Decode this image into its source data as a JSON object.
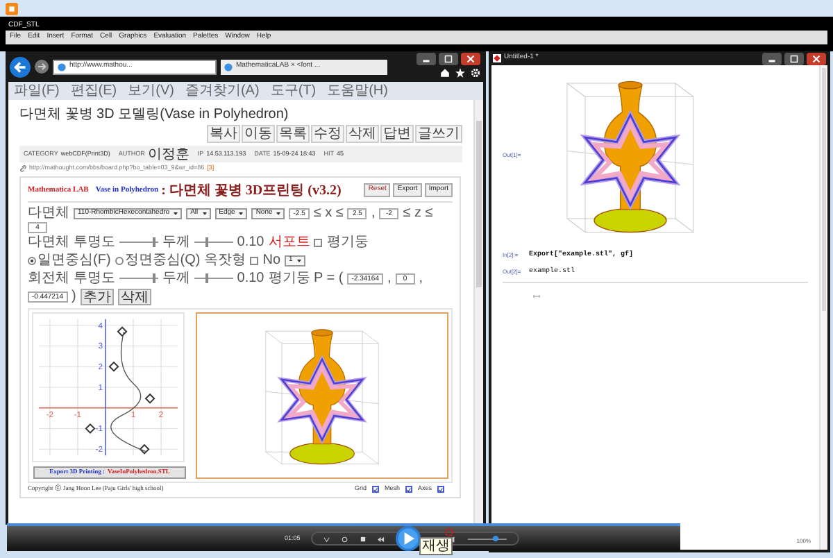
{
  "top_window": {
    "title": "CDF_STL",
    "menu": [
      "File",
      "Edit",
      "Insert",
      "Format",
      "Cell",
      "Graphics",
      "Evaluation",
      "Palettes",
      "Window",
      "Help"
    ]
  },
  "browser": {
    "address": "http://www.mathou...",
    "tab_title": "MathematicaLAB × <font ...",
    "menu": [
      "파일(F)",
      "편집(E)",
      "보기(V)",
      "즐겨찾기(A)",
      "도구(T)",
      "도움말(H)"
    ]
  },
  "post": {
    "title": "다면체 꽃병 3D 모델링(Vase in Polyhedron)",
    "buttons": [
      "복사",
      "이동",
      "목록",
      "수정",
      "삭제",
      "답변",
      "글쓰기"
    ],
    "meta": [
      {
        "label": "CATEGORY",
        "value": "webCDF(Print3D)"
      },
      {
        "label": "AUTHOR",
        "value": "이정훈"
      },
      {
        "label": "IP",
        "value": "14.53.113.193"
      },
      {
        "label": "DATE",
        "value": "15-09-24 18:43"
      },
      {
        "label": "HIT",
        "value": "45"
      }
    ],
    "link": "http://mathought.com/bbs/board.php?bo_table=03_9&wr_id=86",
    "link_count": "[3]"
  },
  "app": {
    "brand": "Mathematica LAB",
    "title": "Vase in Polyhedron",
    "subtitle": ": 다면체 꽃병 3D프린팅 (v3.2)",
    "buttons": [
      "Reset",
      "Export",
      "Import"
    ],
    "control_rows": [
      {
        "controls": [
          {
            "kind": "label",
            "text": "다면체"
          },
          {
            "kind": "select",
            "text": "110-RhombicHexecontahedro"
          },
          {
            "kind": "select",
            "text": "All"
          },
          {
            "kind": "select",
            "text": "Edge"
          },
          {
            "kind": "select",
            "text": "None"
          },
          {
            "kind": "input",
            "text": "-2.5"
          },
          {
            "kind": "label",
            "text": "≤ x ≤"
          },
          {
            "kind": "input",
            "text": "2.5"
          },
          {
            "kind": "label",
            "text": ","
          },
          {
            "kind": "input",
            "text": "-2"
          },
          {
            "kind": "label",
            "text": "≤ z ≤"
          },
          {
            "kind": "input",
            "text": "4"
          }
        ]
      },
      {
        "controls": [
          {
            "kind": "label",
            "text": "다면체 투명도"
          },
          {
            "kind": "slider",
            "level": 0.95
          },
          {
            "kind": "label",
            "text": "두께"
          },
          {
            "kind": "slider",
            "level": 0.3
          },
          {
            "kind": "label",
            "text": "0.10"
          },
          {
            "kind": "alert",
            "text": "서포트"
          },
          {
            "kind": "checkbox",
            "checked": false
          },
          {
            "kind": "label",
            "text": "평기둥"
          },
          {
            "kind": "radio",
            "text": "일면중심(F)",
            "selected": true
          },
          {
            "kind": "radio",
            "text": "정면중심(Q)",
            "selected": false
          },
          {
            "kind": "label",
            "text": "옥잣형"
          },
          {
            "kind": "checkbox",
            "checked": false
          },
          {
            "kind": "label",
            "text": "No"
          },
          {
            "kind": "select",
            "text": "1"
          }
        ]
      },
      {
        "controls": [
          {
            "kind": "label",
            "text": "회전체 투명도"
          },
          {
            "kind": "slider",
            "level": 0.95
          },
          {
            "kind": "label",
            "text": "두께"
          },
          {
            "kind": "slider",
            "level": 0.3
          },
          {
            "kind": "label",
            "text": "0.10"
          },
          {
            "kind": "label",
            "text": "평기둥 P = ("
          },
          {
            "kind": "input",
            "text": "-2.34164"
          },
          {
            "kind": "label",
            "text": ","
          },
          {
            "kind": "input",
            "text": "0"
          },
          {
            "kind": "label",
            "text": ","
          },
          {
            "kind": "input",
            "text": "-0.447214"
          },
          {
            "kind": "label",
            "text": ")"
          },
          {
            "kind": "button",
            "text": "추가"
          },
          {
            "kind": "button",
            "text": "삭제"
          }
        ]
      }
    ],
    "chart_data": {
      "type": "scatter",
      "xlim": [
        -2.4,
        2.6
      ],
      "ylim": [
        -2.3,
        4.3
      ],
      "xticks": [
        -2,
        -1,
        1,
        2
      ],
      "yticks": [
        -2,
        -1,
        1,
        2,
        3,
        4
      ],
      "grid": true,
      "x": [
        0.6,
        0.3,
        1.6,
        -0.55,
        1.4
      ],
      "series": [
        {
          "color": "#333333",
          "values": [
            3.7,
            2,
            0.45,
            -1,
            -2
          ]
        }
      ]
    },
    "export_label": "Export 3D Printing :",
    "export_file": "VaseInPolyhedron.STL",
    "copyright": "Copyright ⓒ Jang Hoon Lee (Paju Girls' high school)",
    "toggles": [
      {
        "label": "Grid",
        "checked": true
      },
      {
        "label": "Mesh",
        "checked": true
      },
      {
        "label": "Axes",
        "checked": true
      }
    ]
  },
  "notebook": {
    "title": "Untitled-1 *",
    "plot_label": "Out[1]=",
    "cells": [
      {
        "label": "In[2]:=",
        "code": "Export[\"example.stl\", gf]"
      },
      {
        "label": "Out[2]=",
        "code": "example.stl"
      }
    ],
    "zoom": "100%"
  },
  "media": {
    "time": "01:05",
    "tooltip": "재생",
    "volume": {
      "level": 0.75
    }
  }
}
